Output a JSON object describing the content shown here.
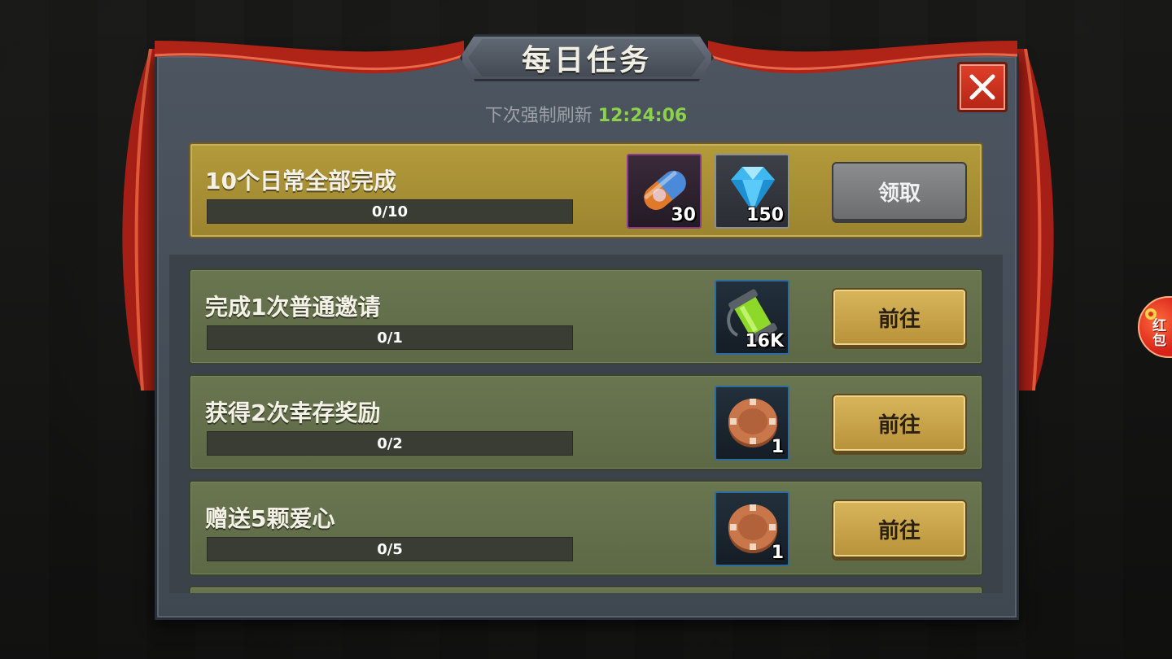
{
  "dialog": {
    "title": "每日任务",
    "refresh_label": "下次强制刷新",
    "refresh_time": "12:24:06"
  },
  "summary_task": {
    "title": "10个日常全部完成",
    "progress": "0/10",
    "progress_fraction": 0,
    "rewards": [
      {
        "icon": "capsule-icon",
        "count": "30"
      },
      {
        "icon": "diamond-icon",
        "count": "150"
      }
    ],
    "button_label": "领取"
  },
  "tasks": [
    {
      "title": "完成1次普通邀请",
      "progress": "0/1",
      "progress_fraction": 0,
      "reward": {
        "icon": "green-canister-icon",
        "count": "16K"
      },
      "button_label": "前往"
    },
    {
      "title": "获得2次幸存奖励",
      "progress": "0/2",
      "progress_fraction": 0,
      "reward": {
        "icon": "chip-token-icon",
        "count": "1"
      },
      "button_label": "前往"
    },
    {
      "title": "赠送5颗爱心",
      "progress": "0/5",
      "progress_fraction": 0,
      "reward": {
        "icon": "chip-token-icon",
        "count": "1"
      },
      "button_label": "前往"
    }
  ],
  "side_widget": {
    "label": "红包",
    "icon": "red-envelope-icon"
  },
  "colors": {
    "accent_gold": "#b39a3a",
    "row_green": "#6a7650",
    "close_red": "#d8341f",
    "time_green": "#8bd14a"
  }
}
